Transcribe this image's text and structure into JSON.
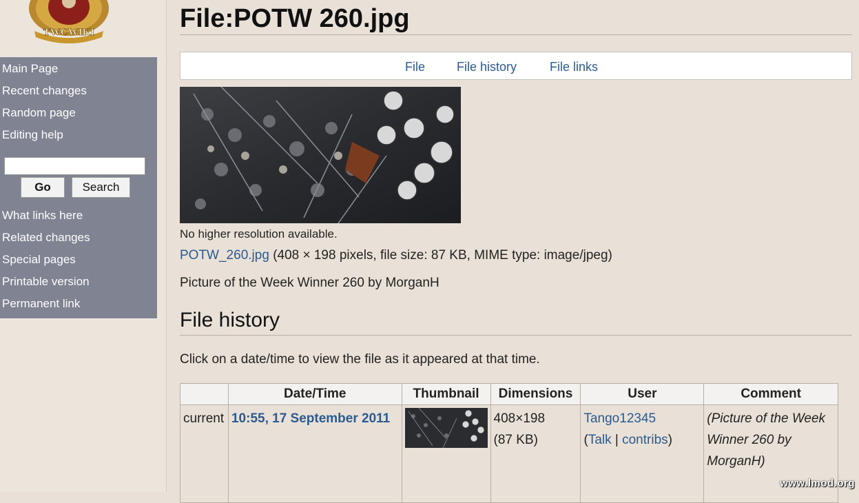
{
  "sidebar": {
    "logo_text": "TWCWIKI",
    "nav": [
      "Main Page",
      "Recent changes",
      "Random page",
      "Editing help"
    ],
    "search": {
      "value": "",
      "go_label": "Go",
      "search_label": "Search"
    },
    "toolbox": [
      "What links here",
      "Related changes",
      "Special pages",
      "Printable version",
      "Permanent link"
    ]
  },
  "page": {
    "title": "File:POTW 260.jpg",
    "tabs": [
      "File",
      "File history",
      "File links"
    ],
    "no_higher_res": "No higher resolution available.",
    "file_link": "POTW_260.jpg",
    "file_info": "(408 × 198 pixels, file size: 87 KB, MIME type: image/jpeg)",
    "description": "Picture of the Week Winner 260 by MorganH",
    "history_heading": "File history",
    "history_intro": "Click on a date/time to view the file as it appeared at that time."
  },
  "history_table": {
    "headers": [
      "",
      "Date/Time",
      "Thumbnail",
      "Dimensions",
      "User",
      "Comment"
    ],
    "row": {
      "status": "current",
      "datetime": "10:55, 17 September 2011",
      "dimensions": "408×198",
      "size": "(87 KB)",
      "user": "Tango12345",
      "talk": "Talk",
      "contribs": "contribs",
      "comment": "(Picture of the Week Winner 260 by MorganH)"
    }
  },
  "watermark": "www.lmod.org",
  "colors": {
    "link": "#2a5a90",
    "sidebar_portlet": "#7f8392",
    "background": "#e9e1d7"
  }
}
